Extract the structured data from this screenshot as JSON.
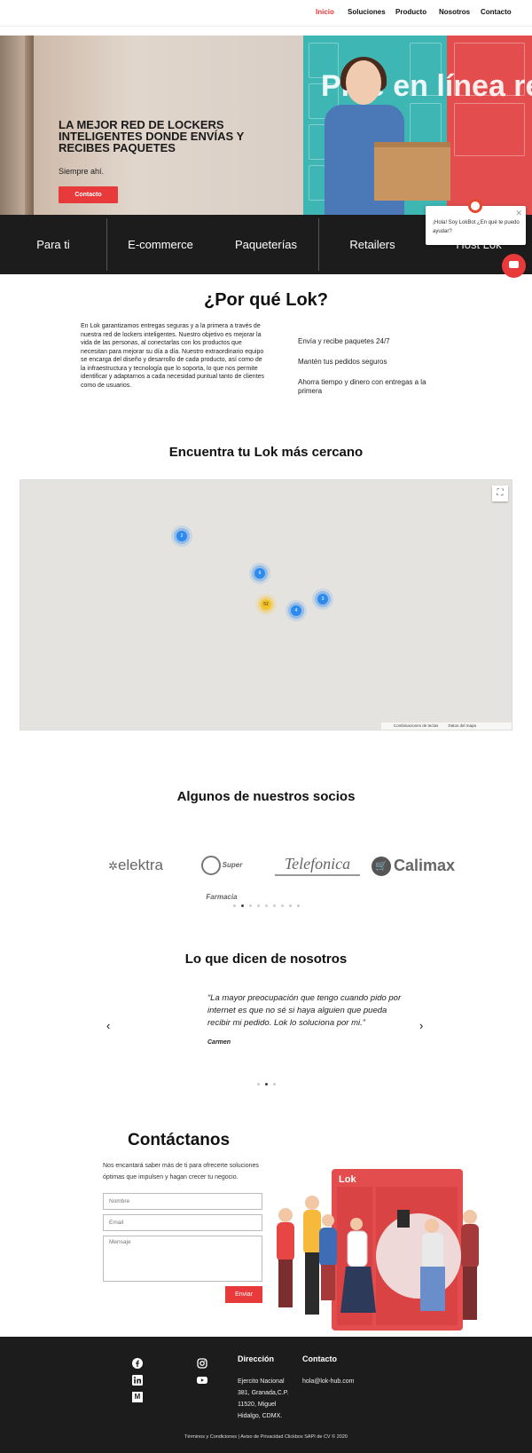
{
  "nav": {
    "items": [
      "Inicio",
      "Soluciones",
      "Producto",
      "Nosotros",
      "Contacto"
    ]
  },
  "hero": {
    "title": "LA MEJOR RED DE LOCKERS INTELIGENTES DONDE ENVÍAS Y RECIBES PAQUETES",
    "subtitle": "Siempre ahí.",
    "button": "Contacto",
    "image_text": "Pide en línea recolecta aquí"
  },
  "categories": [
    "Para ti",
    "E-commerce",
    "Paqueterías",
    "Retailers",
    "Host Lok"
  ],
  "chat": {
    "message": "¡Hola! Soy LokBot ¿En qué te puedo ayudar?"
  },
  "why": {
    "title": "¿Por qué Lok?",
    "text": "En Lok garantizamos entregas seguras y a la primera a través de nuestra red de lockers inteligentes. Nuestro objetivo es mejorar la vida de las personas, al conectarlas con los productos que necesitan para mejorar su día a día. Nuestro extraordinario equipo se encarga del diseño y desarrollo de cada producto, así como de la infraestructura y tecnología que lo soporta, lo que nos permite identificar y adaptarnos a cada necesidad puntual tanto de clientes como de usuarios.",
    "benefits": [
      "Envía y recibe paquetes 24/7",
      "Mantén tus pedidos seguros",
      "Ahorra tiempo y dinero con entregas a la primera"
    ]
  },
  "map": {
    "title": "Encuentra tu Lok más cercano",
    "markers": [
      "2",
      "6",
      "52",
      "4",
      "3"
    ],
    "footer_links": [
      "Combinaciones de teclas",
      "Datos del mapa"
    ]
  },
  "partners": {
    "title": "Algunos de nuestros socios",
    "logos": [
      "elektra",
      "Super Farmacia",
      "Telefonica",
      "Calimax"
    ]
  },
  "testimonials": {
    "title": "Lo que dicen de nosotros",
    "quote": "“La mayor preocupación que tengo cuando pido por internet es que no sé si haya alguien que pueda recibir mi pedido. Lok lo soluciona por mi.”",
    "author": "Carmen"
  },
  "contact": {
    "title": "Contáctanos",
    "intro": "Nos encantará saber más de ti para ofrecerte soluciones óptimas que impulsen y hagan crecer tu negocio.",
    "name_placeholder": "Nombre",
    "email_placeholder": "Email",
    "message_placeholder": "Mensaje",
    "send": "Enviar",
    "locker_brand": "Lok"
  },
  "footer": {
    "address_title": "Dirección",
    "address_lines": [
      "Ejercito Nacional",
      "381, Granada,C.P.",
      "11520, Miguel",
      "Hidalgo, CDMX."
    ],
    "contact_title": "Contacto",
    "email": "hola@lok-hub.com",
    "copyright": "Términos y Condiciones | Aviso de Privacidad Clickbox SAPI de CV © 2020",
    "social": [
      "facebook-icon",
      "instagram-icon",
      "linkedin-icon",
      "youtube-icon",
      "medium-icon"
    ]
  },
  "colors": {
    "accent": "#e83a3a",
    "dark": "#1c1c1c",
    "teal": "#3eb6b3"
  }
}
